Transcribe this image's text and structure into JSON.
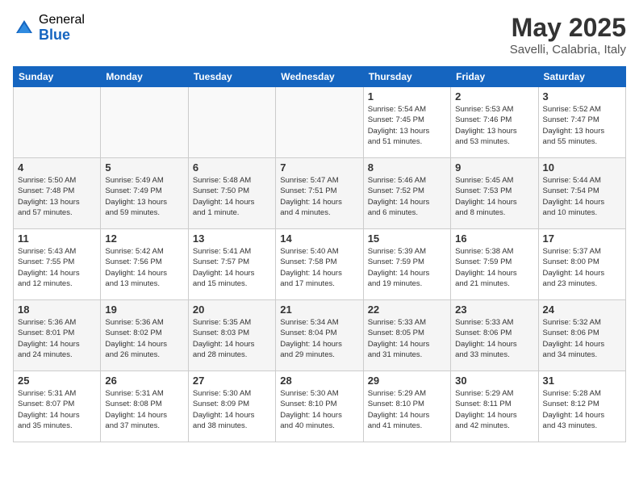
{
  "header": {
    "logo_general": "General",
    "logo_blue": "Blue",
    "title": "May 2025",
    "subtitle": "Savelli, Calabria, Italy"
  },
  "weekdays": [
    "Sunday",
    "Monday",
    "Tuesday",
    "Wednesday",
    "Thursday",
    "Friday",
    "Saturday"
  ],
  "weeks": [
    [
      {
        "day": "",
        "info": ""
      },
      {
        "day": "",
        "info": ""
      },
      {
        "day": "",
        "info": ""
      },
      {
        "day": "",
        "info": ""
      },
      {
        "day": "1",
        "info": "Sunrise: 5:54 AM\nSunset: 7:45 PM\nDaylight: 13 hours\nand 51 minutes."
      },
      {
        "day": "2",
        "info": "Sunrise: 5:53 AM\nSunset: 7:46 PM\nDaylight: 13 hours\nand 53 minutes."
      },
      {
        "day": "3",
        "info": "Sunrise: 5:52 AM\nSunset: 7:47 PM\nDaylight: 13 hours\nand 55 minutes."
      }
    ],
    [
      {
        "day": "4",
        "info": "Sunrise: 5:50 AM\nSunset: 7:48 PM\nDaylight: 13 hours\nand 57 minutes."
      },
      {
        "day": "5",
        "info": "Sunrise: 5:49 AM\nSunset: 7:49 PM\nDaylight: 13 hours\nand 59 minutes."
      },
      {
        "day": "6",
        "info": "Sunrise: 5:48 AM\nSunset: 7:50 PM\nDaylight: 14 hours\nand 1 minute."
      },
      {
        "day": "7",
        "info": "Sunrise: 5:47 AM\nSunset: 7:51 PM\nDaylight: 14 hours\nand 4 minutes."
      },
      {
        "day": "8",
        "info": "Sunrise: 5:46 AM\nSunset: 7:52 PM\nDaylight: 14 hours\nand 6 minutes."
      },
      {
        "day": "9",
        "info": "Sunrise: 5:45 AM\nSunset: 7:53 PM\nDaylight: 14 hours\nand 8 minutes."
      },
      {
        "day": "10",
        "info": "Sunrise: 5:44 AM\nSunset: 7:54 PM\nDaylight: 14 hours\nand 10 minutes."
      }
    ],
    [
      {
        "day": "11",
        "info": "Sunrise: 5:43 AM\nSunset: 7:55 PM\nDaylight: 14 hours\nand 12 minutes."
      },
      {
        "day": "12",
        "info": "Sunrise: 5:42 AM\nSunset: 7:56 PM\nDaylight: 14 hours\nand 13 minutes."
      },
      {
        "day": "13",
        "info": "Sunrise: 5:41 AM\nSunset: 7:57 PM\nDaylight: 14 hours\nand 15 minutes."
      },
      {
        "day": "14",
        "info": "Sunrise: 5:40 AM\nSunset: 7:58 PM\nDaylight: 14 hours\nand 17 minutes."
      },
      {
        "day": "15",
        "info": "Sunrise: 5:39 AM\nSunset: 7:59 PM\nDaylight: 14 hours\nand 19 minutes."
      },
      {
        "day": "16",
        "info": "Sunrise: 5:38 AM\nSunset: 7:59 PM\nDaylight: 14 hours\nand 21 minutes."
      },
      {
        "day": "17",
        "info": "Sunrise: 5:37 AM\nSunset: 8:00 PM\nDaylight: 14 hours\nand 23 minutes."
      }
    ],
    [
      {
        "day": "18",
        "info": "Sunrise: 5:36 AM\nSunset: 8:01 PM\nDaylight: 14 hours\nand 24 minutes."
      },
      {
        "day": "19",
        "info": "Sunrise: 5:36 AM\nSunset: 8:02 PM\nDaylight: 14 hours\nand 26 minutes."
      },
      {
        "day": "20",
        "info": "Sunrise: 5:35 AM\nSunset: 8:03 PM\nDaylight: 14 hours\nand 28 minutes."
      },
      {
        "day": "21",
        "info": "Sunrise: 5:34 AM\nSunset: 8:04 PM\nDaylight: 14 hours\nand 29 minutes."
      },
      {
        "day": "22",
        "info": "Sunrise: 5:33 AM\nSunset: 8:05 PM\nDaylight: 14 hours\nand 31 minutes."
      },
      {
        "day": "23",
        "info": "Sunrise: 5:33 AM\nSunset: 8:06 PM\nDaylight: 14 hours\nand 33 minutes."
      },
      {
        "day": "24",
        "info": "Sunrise: 5:32 AM\nSunset: 8:06 PM\nDaylight: 14 hours\nand 34 minutes."
      }
    ],
    [
      {
        "day": "25",
        "info": "Sunrise: 5:31 AM\nSunset: 8:07 PM\nDaylight: 14 hours\nand 35 minutes."
      },
      {
        "day": "26",
        "info": "Sunrise: 5:31 AM\nSunset: 8:08 PM\nDaylight: 14 hours\nand 37 minutes."
      },
      {
        "day": "27",
        "info": "Sunrise: 5:30 AM\nSunset: 8:09 PM\nDaylight: 14 hours\nand 38 minutes."
      },
      {
        "day": "28",
        "info": "Sunrise: 5:30 AM\nSunset: 8:10 PM\nDaylight: 14 hours\nand 40 minutes."
      },
      {
        "day": "29",
        "info": "Sunrise: 5:29 AM\nSunset: 8:10 PM\nDaylight: 14 hours\nand 41 minutes."
      },
      {
        "day": "30",
        "info": "Sunrise: 5:29 AM\nSunset: 8:11 PM\nDaylight: 14 hours\nand 42 minutes."
      },
      {
        "day": "31",
        "info": "Sunrise: 5:28 AM\nSunset: 8:12 PM\nDaylight: 14 hours\nand 43 minutes."
      }
    ]
  ]
}
